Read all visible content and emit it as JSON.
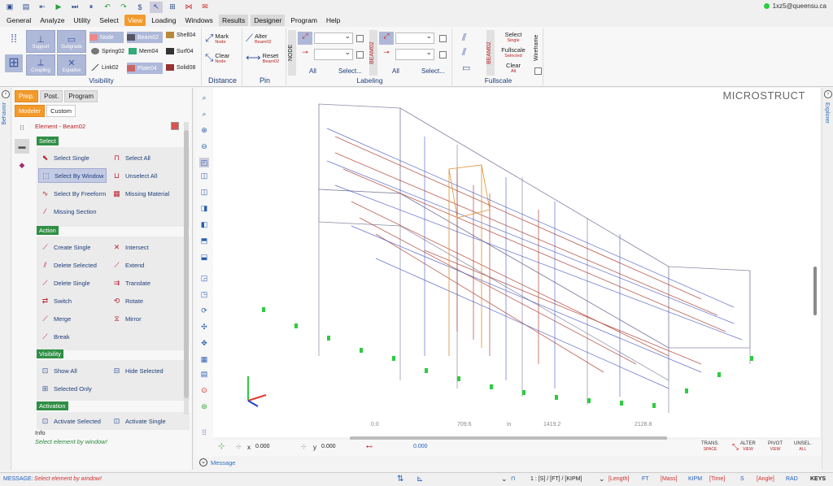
{
  "user": {
    "email": "1xz5@queensu.ca"
  },
  "menu": [
    "General",
    "Analyze",
    "Utility",
    "Select",
    "View",
    "Loading",
    "Windows",
    "Results",
    "Designer",
    "Program",
    "Help"
  ],
  "ribbon": {
    "visibility": {
      "label": "Visibility",
      "tiles": [
        "Support",
        "Subgrade",
        "Coupling",
        "Equalise"
      ],
      "items": [
        "Node",
        "Beam02",
        "Shell04",
        "Spring02",
        "Mem04",
        "Surf04",
        "Link02",
        "Plate04",
        "Solid08"
      ]
    },
    "distance": {
      "label": "Distance",
      "mark": "Mark",
      "mark_sub": "Node",
      "clear": "Clear",
      "clear_sub": "Node"
    },
    "pin": {
      "label": "Pin",
      "alter": "Alter",
      "alter_sub": "Beam02",
      "reset": "Reset",
      "reset_sub": "Beam02"
    },
    "labeling": {
      "label": "Labeling",
      "node_tag": "NODE",
      "beam_tag": "BEAM02",
      "all": "All",
      "select": "Select...",
      "all2": "All",
      "select2": "Select..."
    },
    "fullscale": {
      "label": "Fullscale",
      "tag": "BEAM02",
      "select": "Select",
      "select_sub": "Single",
      "fullscale": "Fullscale",
      "fullscale_sub": "Selected",
      "clear": "Clear",
      "clear_sub": "All",
      "wireframe": "Wireframe"
    }
  },
  "side": {
    "left": "Behavior",
    "right": "Explorer"
  },
  "panel": {
    "tabs": [
      "Prep.",
      "Post.",
      "Program"
    ],
    "subtabs": [
      "Modeler",
      "Custom"
    ],
    "element_header": "Element - Beam02",
    "select": {
      "title": "Select",
      "buttons": [
        "Select Single",
        "Select All",
        "Select By Window",
        "Unselect All",
        "Select By Freeform",
        "Missing Material",
        "Missing Section"
      ]
    },
    "action": {
      "title": "Action",
      "buttons": [
        "Create Single",
        "Intersect",
        "Delete Selected",
        "Extend",
        "Delete Single",
        "Translate",
        "Switch",
        "Rotate",
        "Merge",
        "Mirror",
        "Break"
      ]
    },
    "visibility": {
      "title": "Visibility",
      "buttons": [
        "Show All",
        "Hide Selected",
        "Selected Only"
      ]
    },
    "activation": {
      "title": "Activation",
      "buttons": [
        "Activate Selected",
        "Activate Single"
      ]
    },
    "info_label": "Info",
    "info_text": "Select element by window!"
  },
  "viewport": {
    "title": "MICROSTRUCT",
    "ruler": [
      "0.0",
      "709.6",
      "in",
      "1419.2",
      "2128.8"
    ]
  },
  "coords": {
    "x_label": "x",
    "x": "0.000",
    "y_label": "y",
    "y": "0.000",
    "z": "0.000"
  },
  "coord_buttons": [
    {
      "label": "TRANS.",
      "sub": "SPACE"
    },
    {
      "label": "ALTER",
      "sub": "VIEW"
    },
    {
      "label": "PIVOT",
      "sub": "VIEW"
    },
    {
      "label": "UNSEL.",
      "sub": "ALL"
    }
  ],
  "message_row": "Message",
  "status": {
    "message_label": "MESSAGE:",
    "message": "Select element by window!",
    "units": "1 : [S] / [FT] / [KIPM]",
    "length_label": "[Length]",
    "length": "FT",
    "mass_label": "[Mass]",
    "mass": "KIPM",
    "time_label": "[Time]",
    "time": "S",
    "angle_label": "[Angle]",
    "angle": "RAD",
    "keys": "KEYS"
  },
  "colors": {
    "accent": "#f39a2b",
    "section": "#2f8f45",
    "tile": "#aeb8d8"
  }
}
